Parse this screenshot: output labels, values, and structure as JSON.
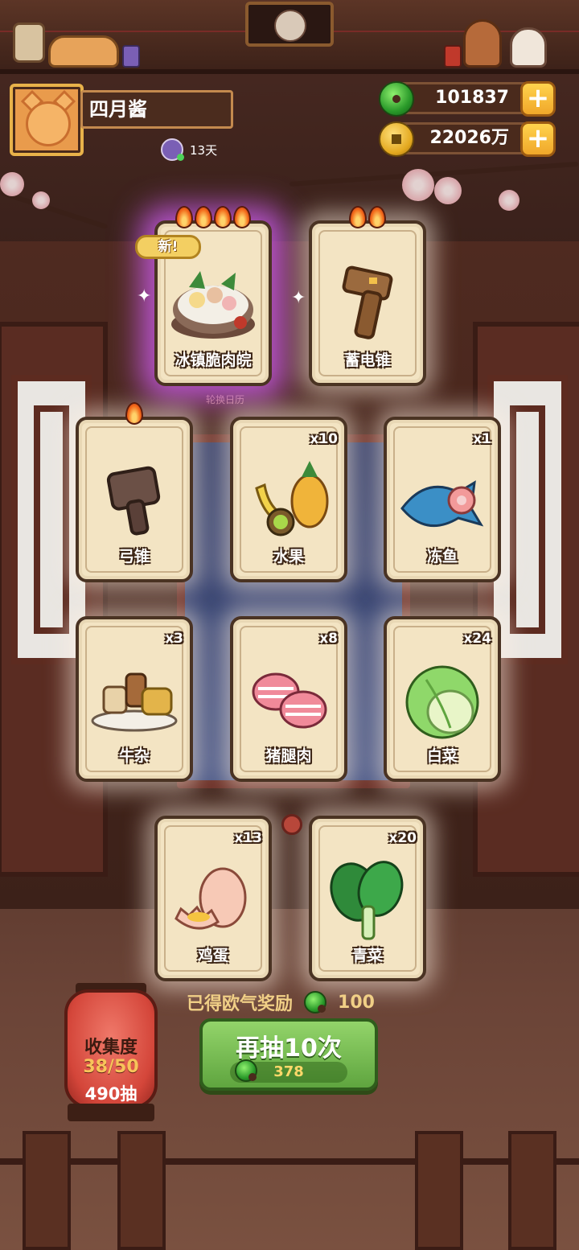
{
  "player": {
    "name": "四月酱",
    "days": "13天"
  },
  "currency": {
    "jade": "101837",
    "coins": "22026万"
  },
  "calendar_label": "轮换日历",
  "cards": [
    {
      "label": "冰镇脆肉皖",
      "count": "",
      "flames": 4,
      "new": true,
      "new_text": "新!",
      "rarity": "purple",
      "icon": "hotpot-icon"
    },
    {
      "label": "蓄电锥",
      "count": "",
      "flames": 2,
      "new": false,
      "rarity": "normal",
      "icon": "hammer-icon"
    },
    {
      "label": "弓锥",
      "count": "",
      "flames": 1,
      "new": false,
      "rarity": "normal",
      "icon": "mallet-icon"
    },
    {
      "label": "水果",
      "count": "x10",
      "flames": 0,
      "new": false,
      "rarity": "normal",
      "icon": "fruit-icon"
    },
    {
      "label": "冻鱼",
      "count": "x1",
      "flames": 0,
      "new": false,
      "rarity": "normal",
      "icon": "fish-icon"
    },
    {
      "label": "牛杂",
      "count": "x3",
      "flames": 0,
      "new": false,
      "rarity": "normal",
      "icon": "offal-icon"
    },
    {
      "label": "猪腿肉",
      "count": "x8",
      "flames": 0,
      "new": false,
      "rarity": "normal",
      "icon": "pork-icon"
    },
    {
      "label": "白菜",
      "count": "x24",
      "flames": 0,
      "new": false,
      "rarity": "normal",
      "icon": "cabbage-icon"
    },
    {
      "label": "鸡蛋",
      "count": "x13",
      "flames": 0,
      "new": false,
      "rarity": "normal",
      "icon": "egg-icon"
    },
    {
      "label": "青菜",
      "count": "x20",
      "flames": 0,
      "new": false,
      "rarity": "normal",
      "icon": "greens-icon"
    }
  ],
  "reward": {
    "text": "已得欧气奖励",
    "value": "100"
  },
  "draw_button": {
    "title": "再抽10次",
    "cost": "378"
  },
  "collection": {
    "title": "收集度",
    "progress": "38/50",
    "draws": "490抽"
  },
  "colors": {
    "card_bg": "#f3e4c3",
    "purple_glow": "#c85ae6",
    "button_green": "#5fa53f",
    "lantern_red": "#d4463a",
    "gold_text": "#f0cf86"
  }
}
